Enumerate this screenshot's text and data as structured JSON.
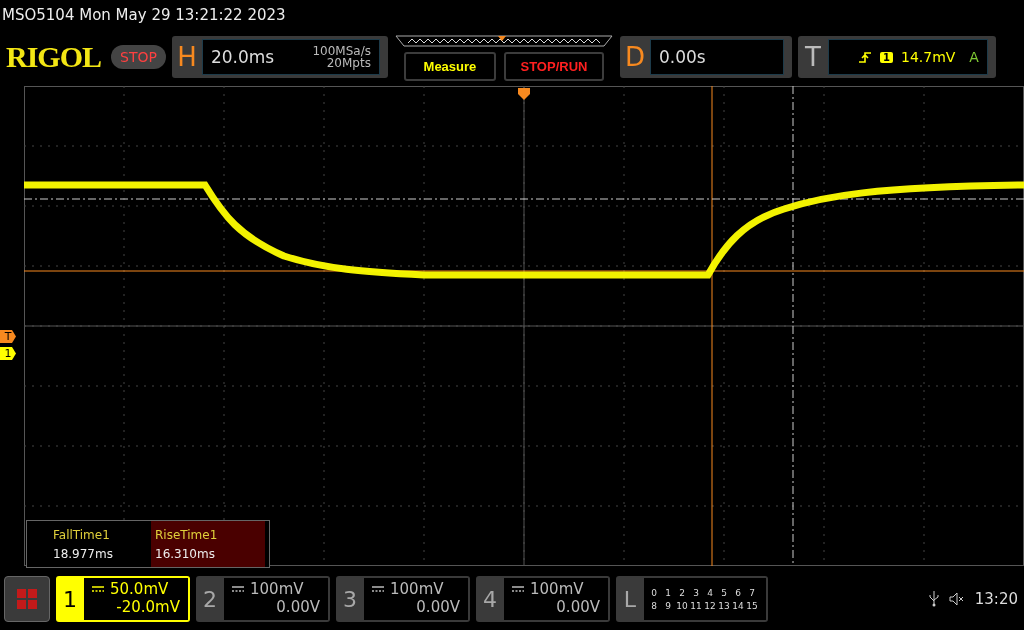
{
  "status_title": "MSO5104  Mon May 29 13:21:22 2023",
  "logo": "RIGOL",
  "run_state": "STOP",
  "horizontal": {
    "label": "H",
    "timebase": "20.0ms",
    "sample_rate": "100MSa/s",
    "memory_depth": "20Mpts"
  },
  "buttons": [
    {
      "label": "Measure",
      "kind": "measure"
    },
    {
      "label": "STOP/RUN",
      "kind": "stoprun"
    }
  ],
  "delay": {
    "label": "D",
    "value": "0.00s"
  },
  "trigger": {
    "label": "T",
    "source": "1",
    "level": "14.7mV",
    "mode": "A"
  },
  "markers": [
    {
      "label": "T",
      "kind": "trigger"
    },
    {
      "label": "1",
      "kind": "channel"
    }
  ],
  "measurements": [
    {
      "name": "FallTime1",
      "value": "18.977ms",
      "selected": false
    },
    {
      "name": "RiseTime1",
      "value": "16.310ms",
      "selected": true
    }
  ],
  "channels": [
    {
      "number": "1",
      "scale": "50.0mV",
      "offset": "-20.0mV",
      "selected": true
    },
    {
      "number": "2",
      "scale": "100mV",
      "offset": "0.00V",
      "selected": false
    },
    {
      "number": "3",
      "scale": "100mV",
      "offset": "0.00V",
      "selected": false
    },
    {
      "number": "4",
      "scale": "100mV",
      "offset": "0.00V",
      "selected": false
    }
  ],
  "logic": {
    "label": "L",
    "rows": [
      [
        "0",
        "1",
        "2",
        "3",
        "4",
        "5",
        "6",
        "7"
      ],
      [
        "8",
        "9",
        "10",
        "11",
        "12",
        "13",
        "14",
        "15"
      ]
    ]
  },
  "clock": "13:20"
}
